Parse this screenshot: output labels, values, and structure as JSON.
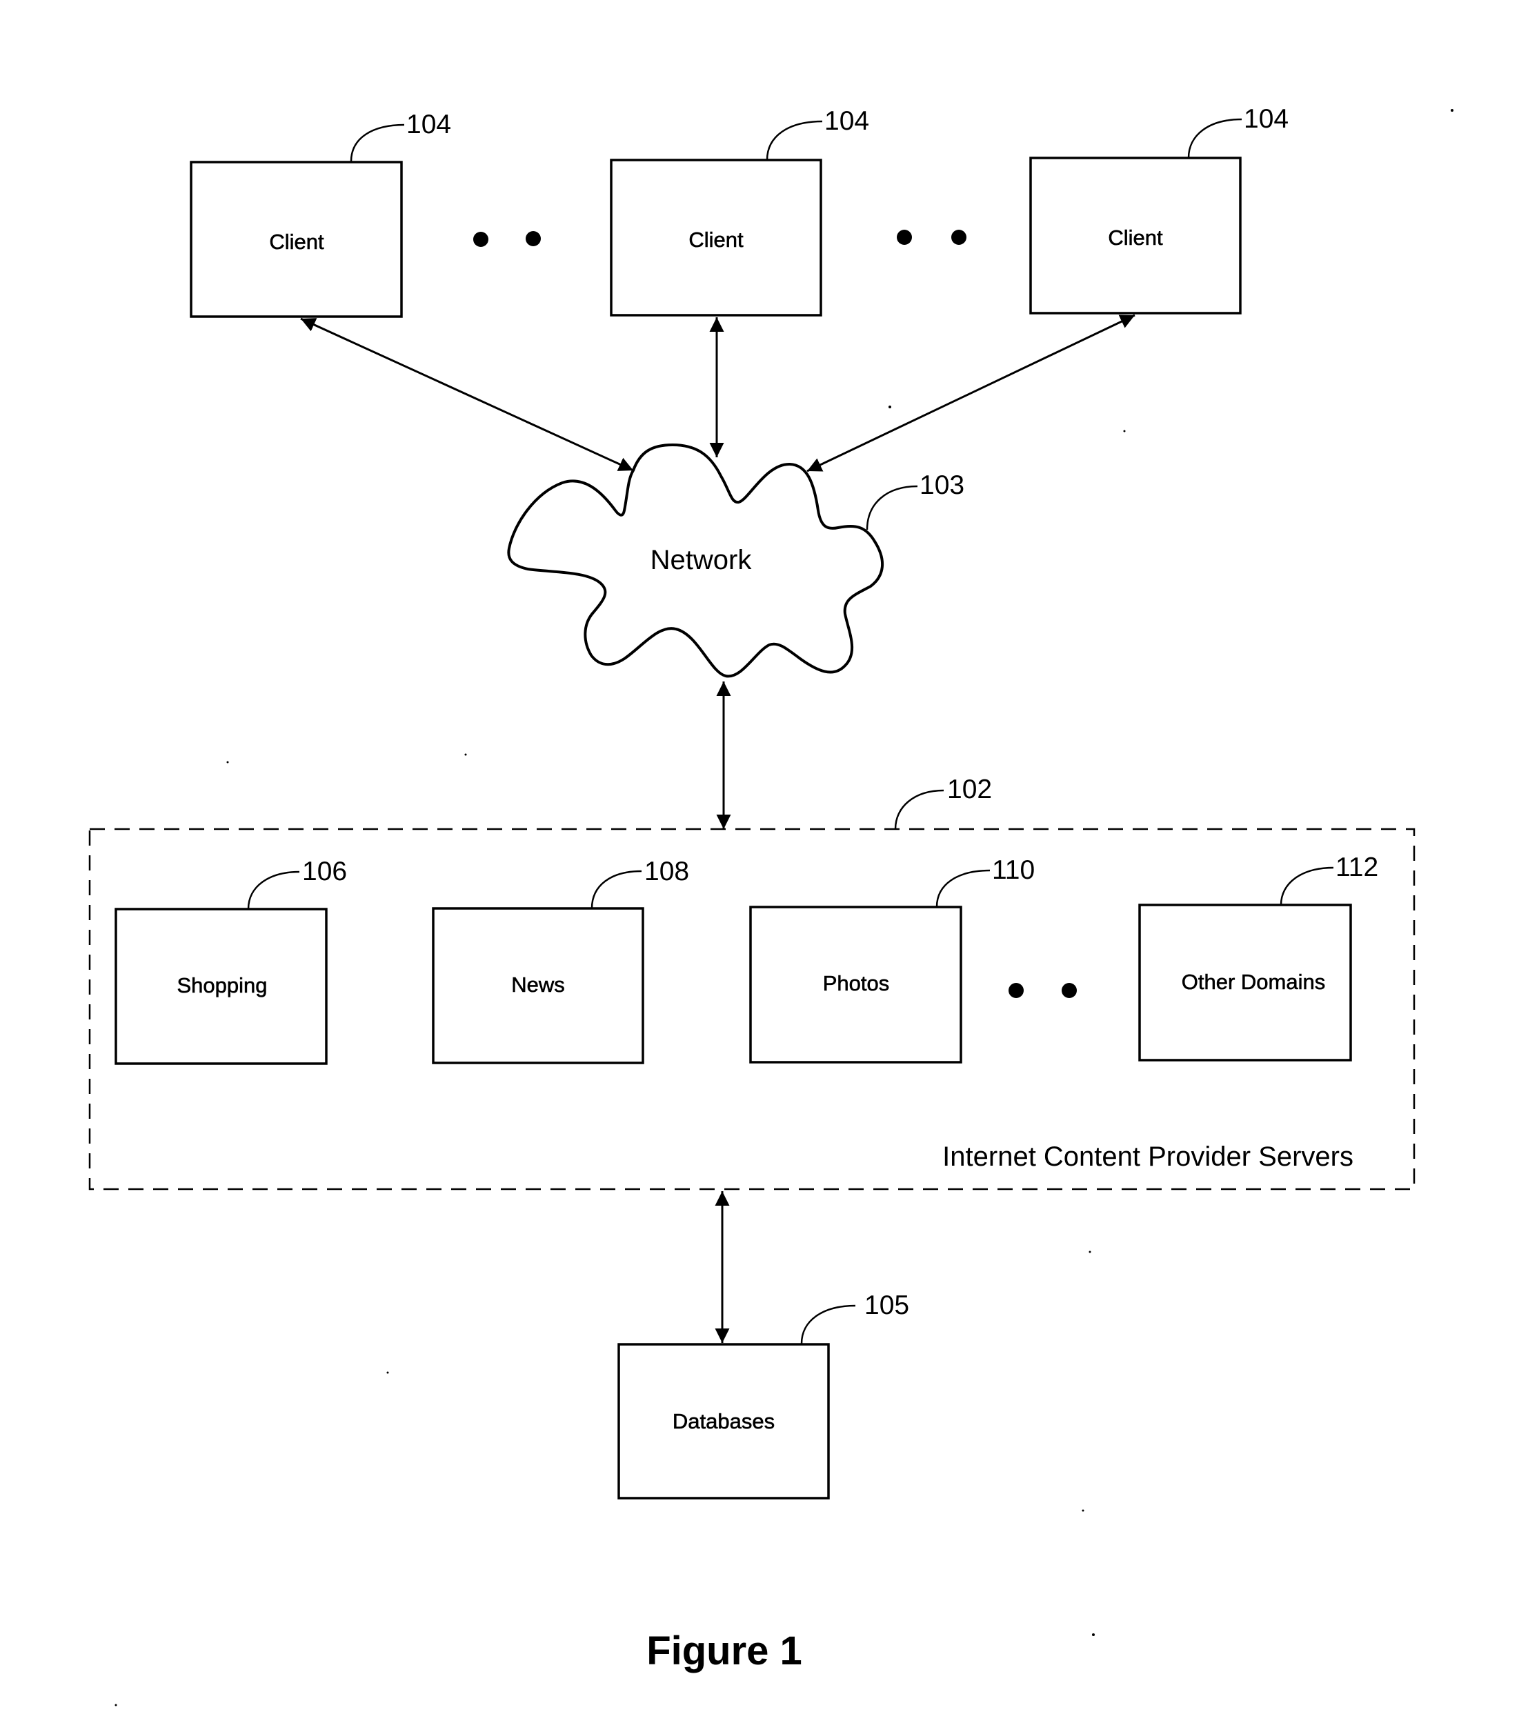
{
  "diagram": {
    "caption": "Figure 1",
    "clients": [
      {
        "label": "Client",
        "ref": "104"
      },
      {
        "label": "Client",
        "ref": "104"
      },
      {
        "label": "Client",
        "ref": "104"
      }
    ],
    "network": {
      "label": "Network",
      "ref": "103"
    },
    "provider_group": {
      "label": "Internet Content Provider Servers",
      "ref": "102",
      "servers": [
        {
          "label": "Shopping",
          "ref": "106"
        },
        {
          "label": "News",
          "ref": "108"
        },
        {
          "label": "Photos",
          "ref": "110"
        },
        {
          "label": "Other Domains",
          "ref": "112"
        }
      ]
    },
    "databases": {
      "label": "Databases",
      "ref": "105"
    },
    "connections": [
      {
        "from": "client-1",
        "to": "network",
        "type": "bidirectional"
      },
      {
        "from": "client-2",
        "to": "network",
        "type": "bidirectional"
      },
      {
        "from": "client-3",
        "to": "network",
        "type": "bidirectional"
      },
      {
        "from": "network",
        "to": "provider-group",
        "type": "bidirectional"
      },
      {
        "from": "provider-group",
        "to": "databases",
        "type": "bidirectional"
      }
    ],
    "ellipsis_icon": "two-dots"
  }
}
